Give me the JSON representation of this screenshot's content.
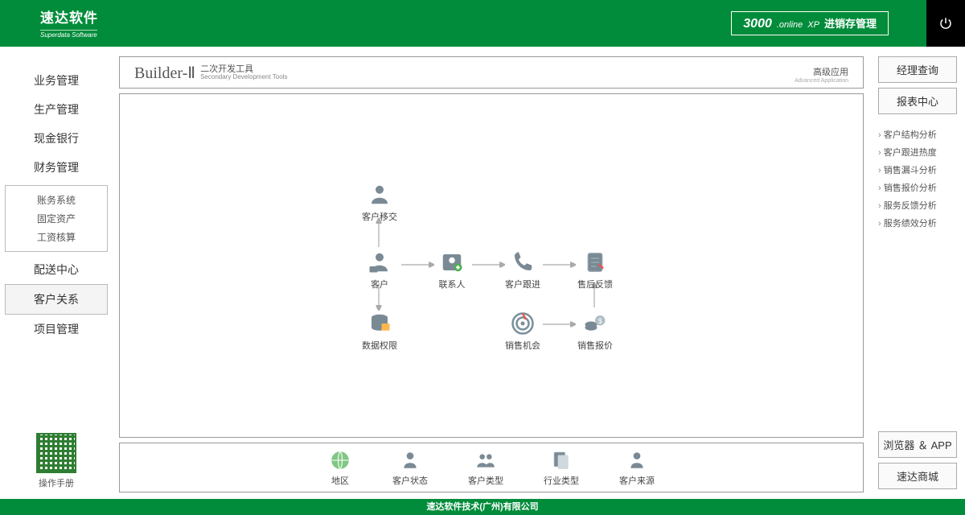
{
  "header": {
    "logo_title": "速达软件",
    "logo_sub": "Superdata Software",
    "product": {
      "p1": "3000",
      "p2": ".online",
      "p3": "XP",
      "p4": "进销存管理"
    }
  },
  "left_nav": {
    "items": [
      "业务管理",
      "生产管理",
      "现金银行",
      "财务管理"
    ],
    "sub_group": [
      "账务系统",
      "固定资产",
      "工资核算"
    ],
    "items2": [
      "配送中心",
      "客户关系",
      "项目管理"
    ],
    "active": "客户关系",
    "qr_label": "操作手册"
  },
  "builder": {
    "title": "Builder-Ⅱ",
    "sub_cn": "二次开发工具",
    "sub_en": "Secondary Development Tools",
    "adv_cn": "高级应用",
    "adv_en": "Advanced Application"
  },
  "flow": {
    "n_transfer": "客户移交",
    "n_customer": "客户",
    "n_contact": "联系人",
    "n_follow": "客户跟进",
    "n_feedback": "售后反馈",
    "n_auth": "数据权限",
    "n_opportunity": "销售机会",
    "n_quote": "销售报价"
  },
  "bottom": {
    "b_region": "地区",
    "b_status": "客户状态",
    "b_type": "客户类型",
    "b_industry": "行业类型",
    "b_source": "客户来源"
  },
  "right": {
    "btns": [
      "经理查询",
      "报表中心"
    ],
    "links": [
      "客户结构分析",
      "客户跟进热度",
      "销售漏斗分析",
      "销售报价分析",
      "服务反馈分析",
      "服务绩效分析"
    ],
    "bottom_btns": [
      "浏览器 ＆ APP",
      "速达商城"
    ]
  },
  "footer": "速达软件技术(广州)有限公司"
}
